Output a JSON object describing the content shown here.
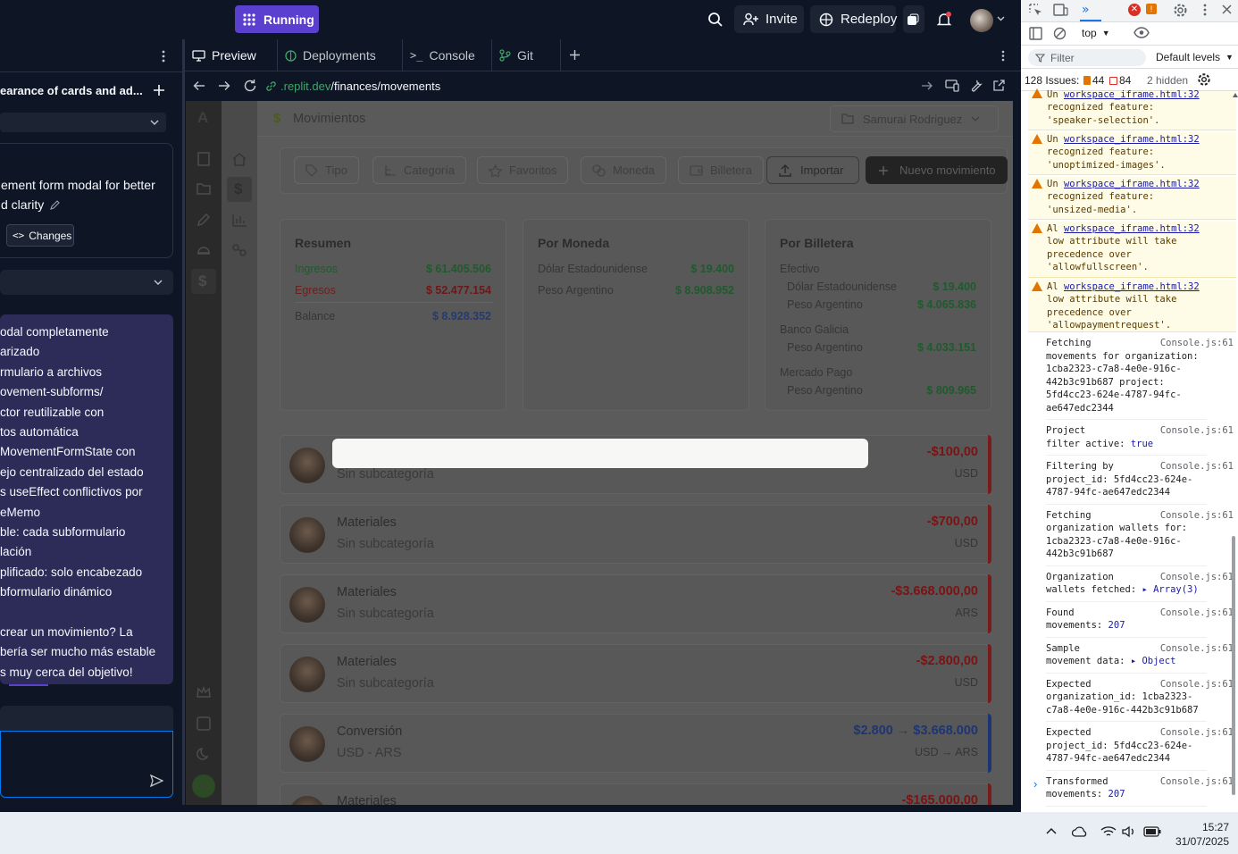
{
  "topbar": {
    "run_label": "Running",
    "invite_label": "Invite",
    "redeploy_label": "Redeploy"
  },
  "left_panel": {
    "thread_title": "earance of cards and ad...",
    "checkpoint_line1": "ement form modal for better",
    "checkpoint_line2": "d clarity",
    "changes_label": "Changes",
    "message_lines": [
      "odal completamente",
      "arizado",
      "rmulario a archivos",
      "ovement-subforms/",
      "ctor reutilizable con",
      "tos automática",
      "MovementFormState con",
      "ejo centralizado del estado",
      "s useEffect conflictivos por",
      "eMemo",
      "ble: cada subformulario",
      "lación",
      "plificado: solo encabezado",
      "bformulario dinámico",
      "",
      "crear un movimiento? La",
      "bería ser mucho más estable",
      "s muy cerca del objetivo!"
    ]
  },
  "workspace_tabs": {
    "preview": "Preview",
    "deployments": "Deployments",
    "console": "Console",
    "git": "Git"
  },
  "url": {
    "host": ".replit.dev",
    "path": "/finances/movements"
  },
  "app": {
    "logo_letter": "A",
    "page_title": "Movimientos",
    "project_selector": "Samurai Rodriguez",
    "filters": [
      "Tipo",
      "Categoría",
      "Favoritos",
      "Moneda",
      "Billetera"
    ],
    "import_label": "Importar",
    "new_label": "Nuevo movimiento",
    "avatar_letter": "A",
    "summary": {
      "title": "Resumen",
      "income_label": "Ingresos",
      "income_value": "$ 61.405.506",
      "expense_label": "Egresos",
      "expense_value": "$ 52.477.154",
      "balance_label": "Balance",
      "balance_value": "$ 8.928.352"
    },
    "by_currency": {
      "title": "Por Moneda",
      "rows": [
        {
          "label": "Dólar Estadounidense",
          "value": "$ 19.400"
        },
        {
          "label": "Peso Argentino",
          "value": "$ 8.908.952"
        }
      ]
    },
    "by_wallet": {
      "title": "Por Billetera",
      "w1": "Efectivo",
      "w1_r1_label": "Dólar Estadounidense",
      "w1_r1_value": "$ 19.400",
      "w1_r2_label": "Peso Argentino",
      "w1_r2_value": "$ 4.065.836",
      "w2": "Banco Galicia",
      "w2_r1_label": "Peso Argentino",
      "w2_r1_value": "$ 4.033.151",
      "w3": "Mercado Pago",
      "w3_r1_label": "Peso Argentino",
      "w3_r1_value": "$ 809.965"
    },
    "movements": [
      {
        "title": "",
        "subtitle": "Sin subcategoría",
        "amount": "-$100,00",
        "currency": "USD"
      },
      {
        "title": "Materiales",
        "subtitle": "Sin subcategoría",
        "amount": "-$700,00",
        "currency": "USD"
      },
      {
        "title": "Materiales",
        "subtitle": "Sin subcategoría",
        "amount": "-$3.668.000,00",
        "currency": "ARS"
      },
      {
        "title": "Materiales",
        "subtitle": "Sin subcategoría",
        "amount": "-$2.800,00",
        "currency": "USD"
      },
      {
        "title": "Conversión",
        "subtitle": "USD - ARS",
        "amount": "$2.800 → $3.668.000",
        "currency": "USD → ARS"
      },
      {
        "title": "Materiales",
        "subtitle": "",
        "amount": "-$165.000,00",
        "currency": ""
      }
    ]
  },
  "devtools": {
    "context": "top",
    "filter_placeholder": "Filter",
    "levels": "Default levels",
    "issues_label": "128 Issues:",
    "issues_warn": "44",
    "issues_info": "84",
    "hidden": "2 hidden",
    "warnings": [
      {
        "prefix": "Un",
        "link": "workspace_iframe.html:32",
        "l2": "recognized feature:",
        "l3": "'speaker-selection'."
      },
      {
        "prefix": "Un",
        "link": "workspace_iframe.html:32",
        "l2": "recognized feature:",
        "l3": "'unoptimized-images'."
      },
      {
        "prefix": "Un",
        "link": "workspace_iframe.html:32",
        "l2": "recognized feature:",
        "l3": "'unsized-media'."
      },
      {
        "prefix": "Al",
        "link": "workspace_iframe.html:32",
        "l2": "low attribute will take",
        "l3": "precedence over",
        "l4": "'allowfullscreen'."
      },
      {
        "prefix": "Al",
        "link": "workspace_iframe.html:32",
        "l2": "low attribute will take",
        "l3": "precedence over",
        "l4": "'allowpaymentrequest'."
      }
    ],
    "logs": [
      {
        "src": "Console.js:61",
        "lines": [
          "Fetching",
          "movements for organization:",
          "1cba2323-c7a8-4e0e-916c-",
          "442b3c91b687 project:",
          "5fd4cc23-624e-4787-94fc-",
          "ae647edc2344"
        ]
      },
      {
        "src": "Console.js:61",
        "lines": [
          "Project",
          "filter active: "
        ],
        "value": "true"
      },
      {
        "src": "Console.js:61",
        "lines": [
          "Filtering by",
          "project_id: 5fd4cc23-624e-",
          "4787-94fc-ae647edc2344"
        ]
      },
      {
        "src": "Console.js:61",
        "lines": [
          "Fetching",
          "organization wallets for:",
          "1cba2323-c7a8-4e0e-916c-",
          "442b3c91b687"
        ]
      },
      {
        "src": "Console.js:61",
        "lines": [
          "Organization",
          "wallets fetched: "
        ],
        "value": "▸ Array(3)"
      },
      {
        "src": "Console.js:61",
        "lines": [
          "Found",
          "movements: "
        ],
        "value": "207"
      },
      {
        "src": "Console.js:61",
        "lines": [
          "Sample",
          "movement data: "
        ],
        "value": "▸ Object"
      },
      {
        "src": "Console.js:61",
        "lines": [
          "Expected",
          "organization_id: 1cba2323-",
          "c7a8-4e0e-916c-442b3c91b687"
        ]
      },
      {
        "src": "Console.js:61",
        "lines": [
          "Expected",
          "project_id: 5fd4cc23-624e-",
          "4787-94fc-ae647edc2344"
        ]
      },
      {
        "src": "Console.js:61",
        "lines": [
          "Transformed",
          "movements: "
        ],
        "value": "207"
      }
    ]
  },
  "taskbar": {
    "time": "15:27",
    "date": "31/07/2025"
  },
  "colors": {
    "accent": "#5b3fcf",
    "income": "#1f7a3a",
    "expense": "#9c1c1c",
    "balance": "#1d3f8a",
    "negative_amount": "#9a1616",
    "conversion": "#1e3e94"
  }
}
